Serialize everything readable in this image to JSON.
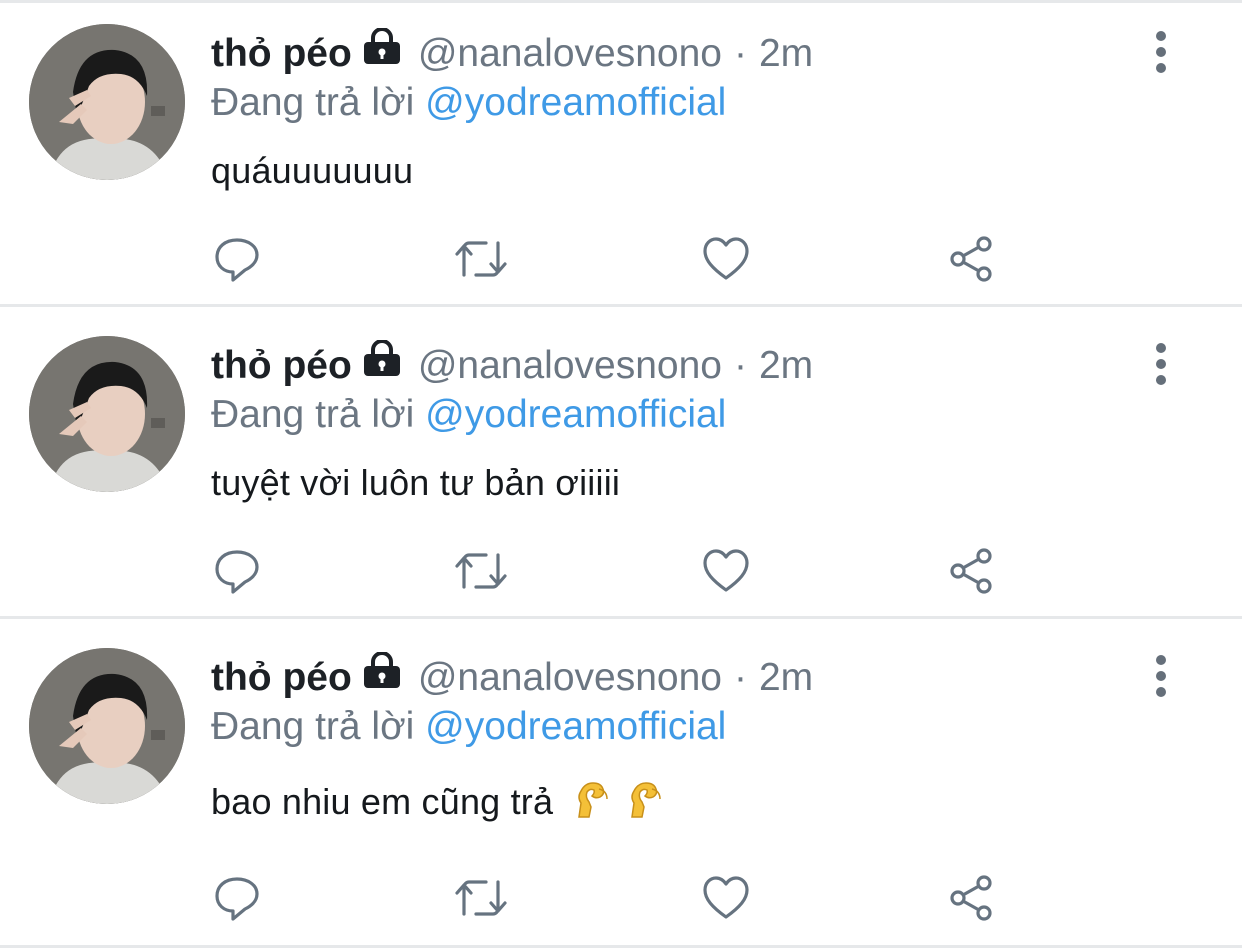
{
  "tweets": [
    {
      "display_name": "thỏ péo",
      "handle": "@nanalovesnono",
      "separator": "·",
      "time": "2m",
      "reply_prefix": "Đang trả lời",
      "reply_to": "@yodreamofficial",
      "text": "quáuuuuuuu",
      "emoji": []
    },
    {
      "display_name": "thỏ péo",
      "handle": "@nanalovesnono",
      "separator": "·",
      "time": "2m",
      "reply_prefix": "Đang trả lời",
      "reply_to": "@yodreamofficial",
      "text": "tuyệt vời luôn tư bản ơiiiii",
      "emoji": []
    },
    {
      "display_name": "thỏ péo",
      "handle": "@nanalovesnono",
      "separator": "·",
      "time": "2m",
      "reply_prefix": "Đang trả lời",
      "reply_to": "@yodreamofficial",
      "text": "bao nhiu em cũng trả",
      "emoji": [
        "pinching-hand-emoji",
        "pinching-hand-emoji"
      ]
    }
  ],
  "icons": {
    "lock": "lock-icon",
    "more": "more-vertical-icon",
    "actions": [
      "reply-icon",
      "retweet-icon",
      "like-icon",
      "share-icon"
    ]
  },
  "colors": {
    "accent": "#3f9ae6",
    "secondary_text": "#6b7682",
    "primary_text": "#15191d",
    "divider": "#e6e8ea"
  }
}
